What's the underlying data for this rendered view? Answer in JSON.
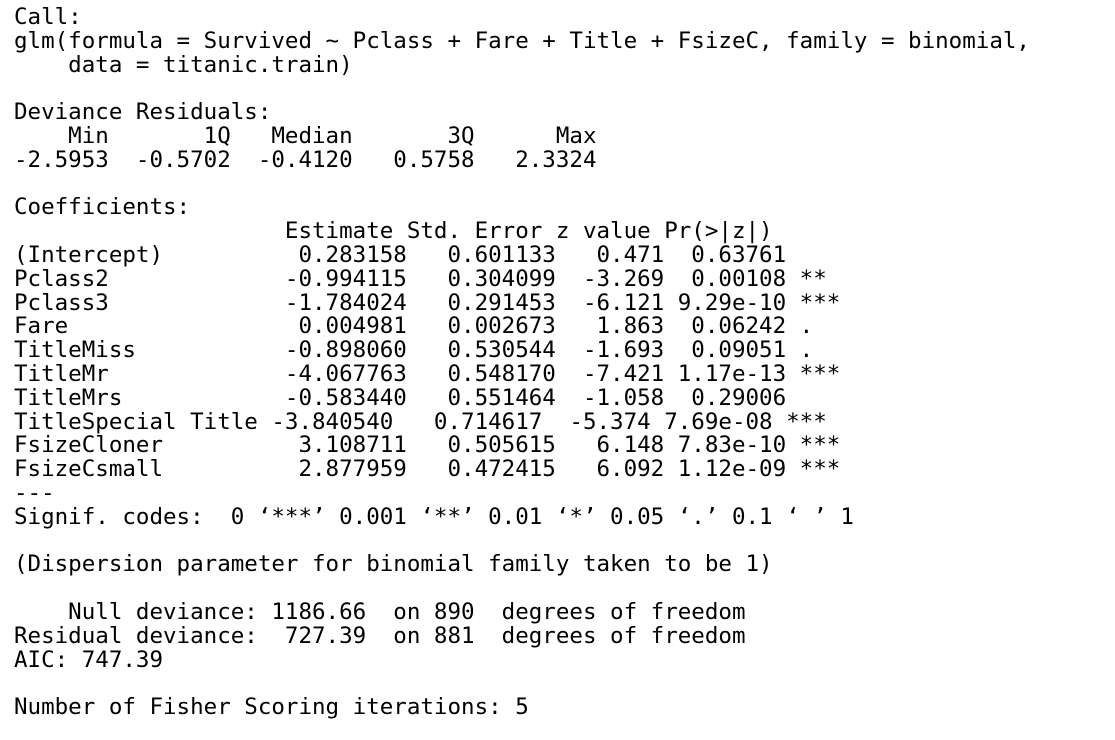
{
  "console": {
    "lines": [
      "Call:",
      "glm(formula = Survived ~ Pclass + Fare + Title + FsizeC, family = binomial,",
      "    data = titanic.train)",
      "",
      "Deviance Residuals:",
      "    Min       1Q   Median       3Q      Max",
      "-2.5953  -0.5702  -0.4120   0.5758   2.3324",
      "",
      "Coefficients:",
      "                    Estimate Std. Error z value Pr(>|z|)",
      "(Intercept)          0.283158   0.601133   0.471  0.63761",
      "Pclass2             -0.994115   0.304099  -3.269  0.00108 **",
      "Pclass3             -1.784024   0.291453  -6.121 9.29e-10 ***",
      "Fare                 0.004981   0.002673   1.863  0.06242 .",
      "TitleMiss           -0.898060   0.530544  -1.693  0.09051 .",
      "TitleMr             -4.067763   0.548170  -7.421 1.17e-13 ***",
      "TitleMrs            -0.583440   0.551464  -1.058  0.29006",
      "TitleSpecial Title -3.840540   0.714617  -5.374 7.69e-08 ***",
      "FsizeCloner          3.108711   0.505615   6.148 7.83e-10 ***",
      "FsizeCsmall          2.877959   0.472415   6.092 1.12e-09 ***",
      "---",
      "Signif. codes:  0 ‘***’ 0.001 ‘**’ 0.01 ‘*’ 0.05 ‘.’ 0.1 ‘ ’ 1",
      "",
      "(Dispersion parameter for binomial family taken to be 1)",
      "",
      "    Null deviance: 1186.66  on 890  degrees of freedom",
      "Residual deviance:  727.39  on 881  degrees of freedom",
      "AIC: 747.39",
      "",
      "Number of Fisher Scoring iterations: 5"
    ]
  }
}
